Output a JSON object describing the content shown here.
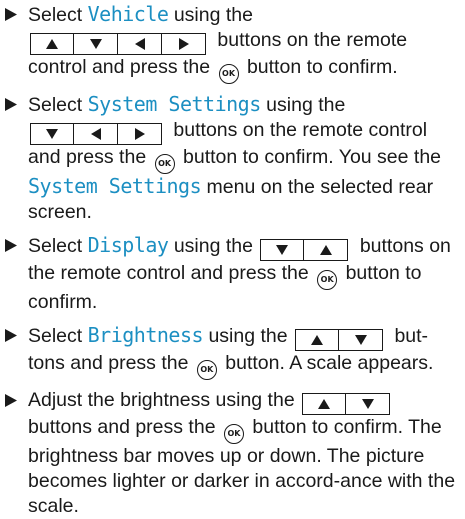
{
  "icons": {
    "bullet": "right-triangle-bullet",
    "up": "up-arrow-button-icon",
    "down": "down-arrow-button-icon",
    "left": "left-arrow-button-icon",
    "right": "right-arrow-button-icon",
    "ok": "ok-button-icon"
  },
  "colors": {
    "highlight": "#1c8fc2",
    "text": "#1a1a1a"
  },
  "ok_label": "OK",
  "steps": [
    {
      "s1_a": "Select ",
      "s1_hl": "Vehicle",
      "s1_b": " using the",
      "s1_c": " buttons on the remote control and press the ",
      "s1_d": " button to confirm."
    },
    {
      "s2_a": "Select ",
      "s2_hl": "System Settings",
      "s2_b": " using the",
      "s2_c": " buttons on the remote control and press the ",
      "s2_d": " button to confirm. You see the ",
      "s2_hl2": "System Settings",
      "s2_e": " menu on the selected rear screen."
    },
    {
      "s3_a": "Select ",
      "s3_hl": "Display",
      "s3_b": " using the",
      "s3_c": " buttons on the remote control and press the ",
      "s3_d": " button to confirm."
    },
    {
      "s4_a": "Select ",
      "s4_hl": "Brightness",
      "s4_b": " using the",
      "s4_c": " but-tons and press the ",
      "s4_d": " button. A scale appears."
    },
    {
      "s5_a": "Adjust the brightness using the",
      "s5_c": " buttons and press the ",
      "s5_d": " button to confirm. The brightness bar moves up or down. The picture becomes lighter or darker in accord-ance with the scale."
    }
  ]
}
